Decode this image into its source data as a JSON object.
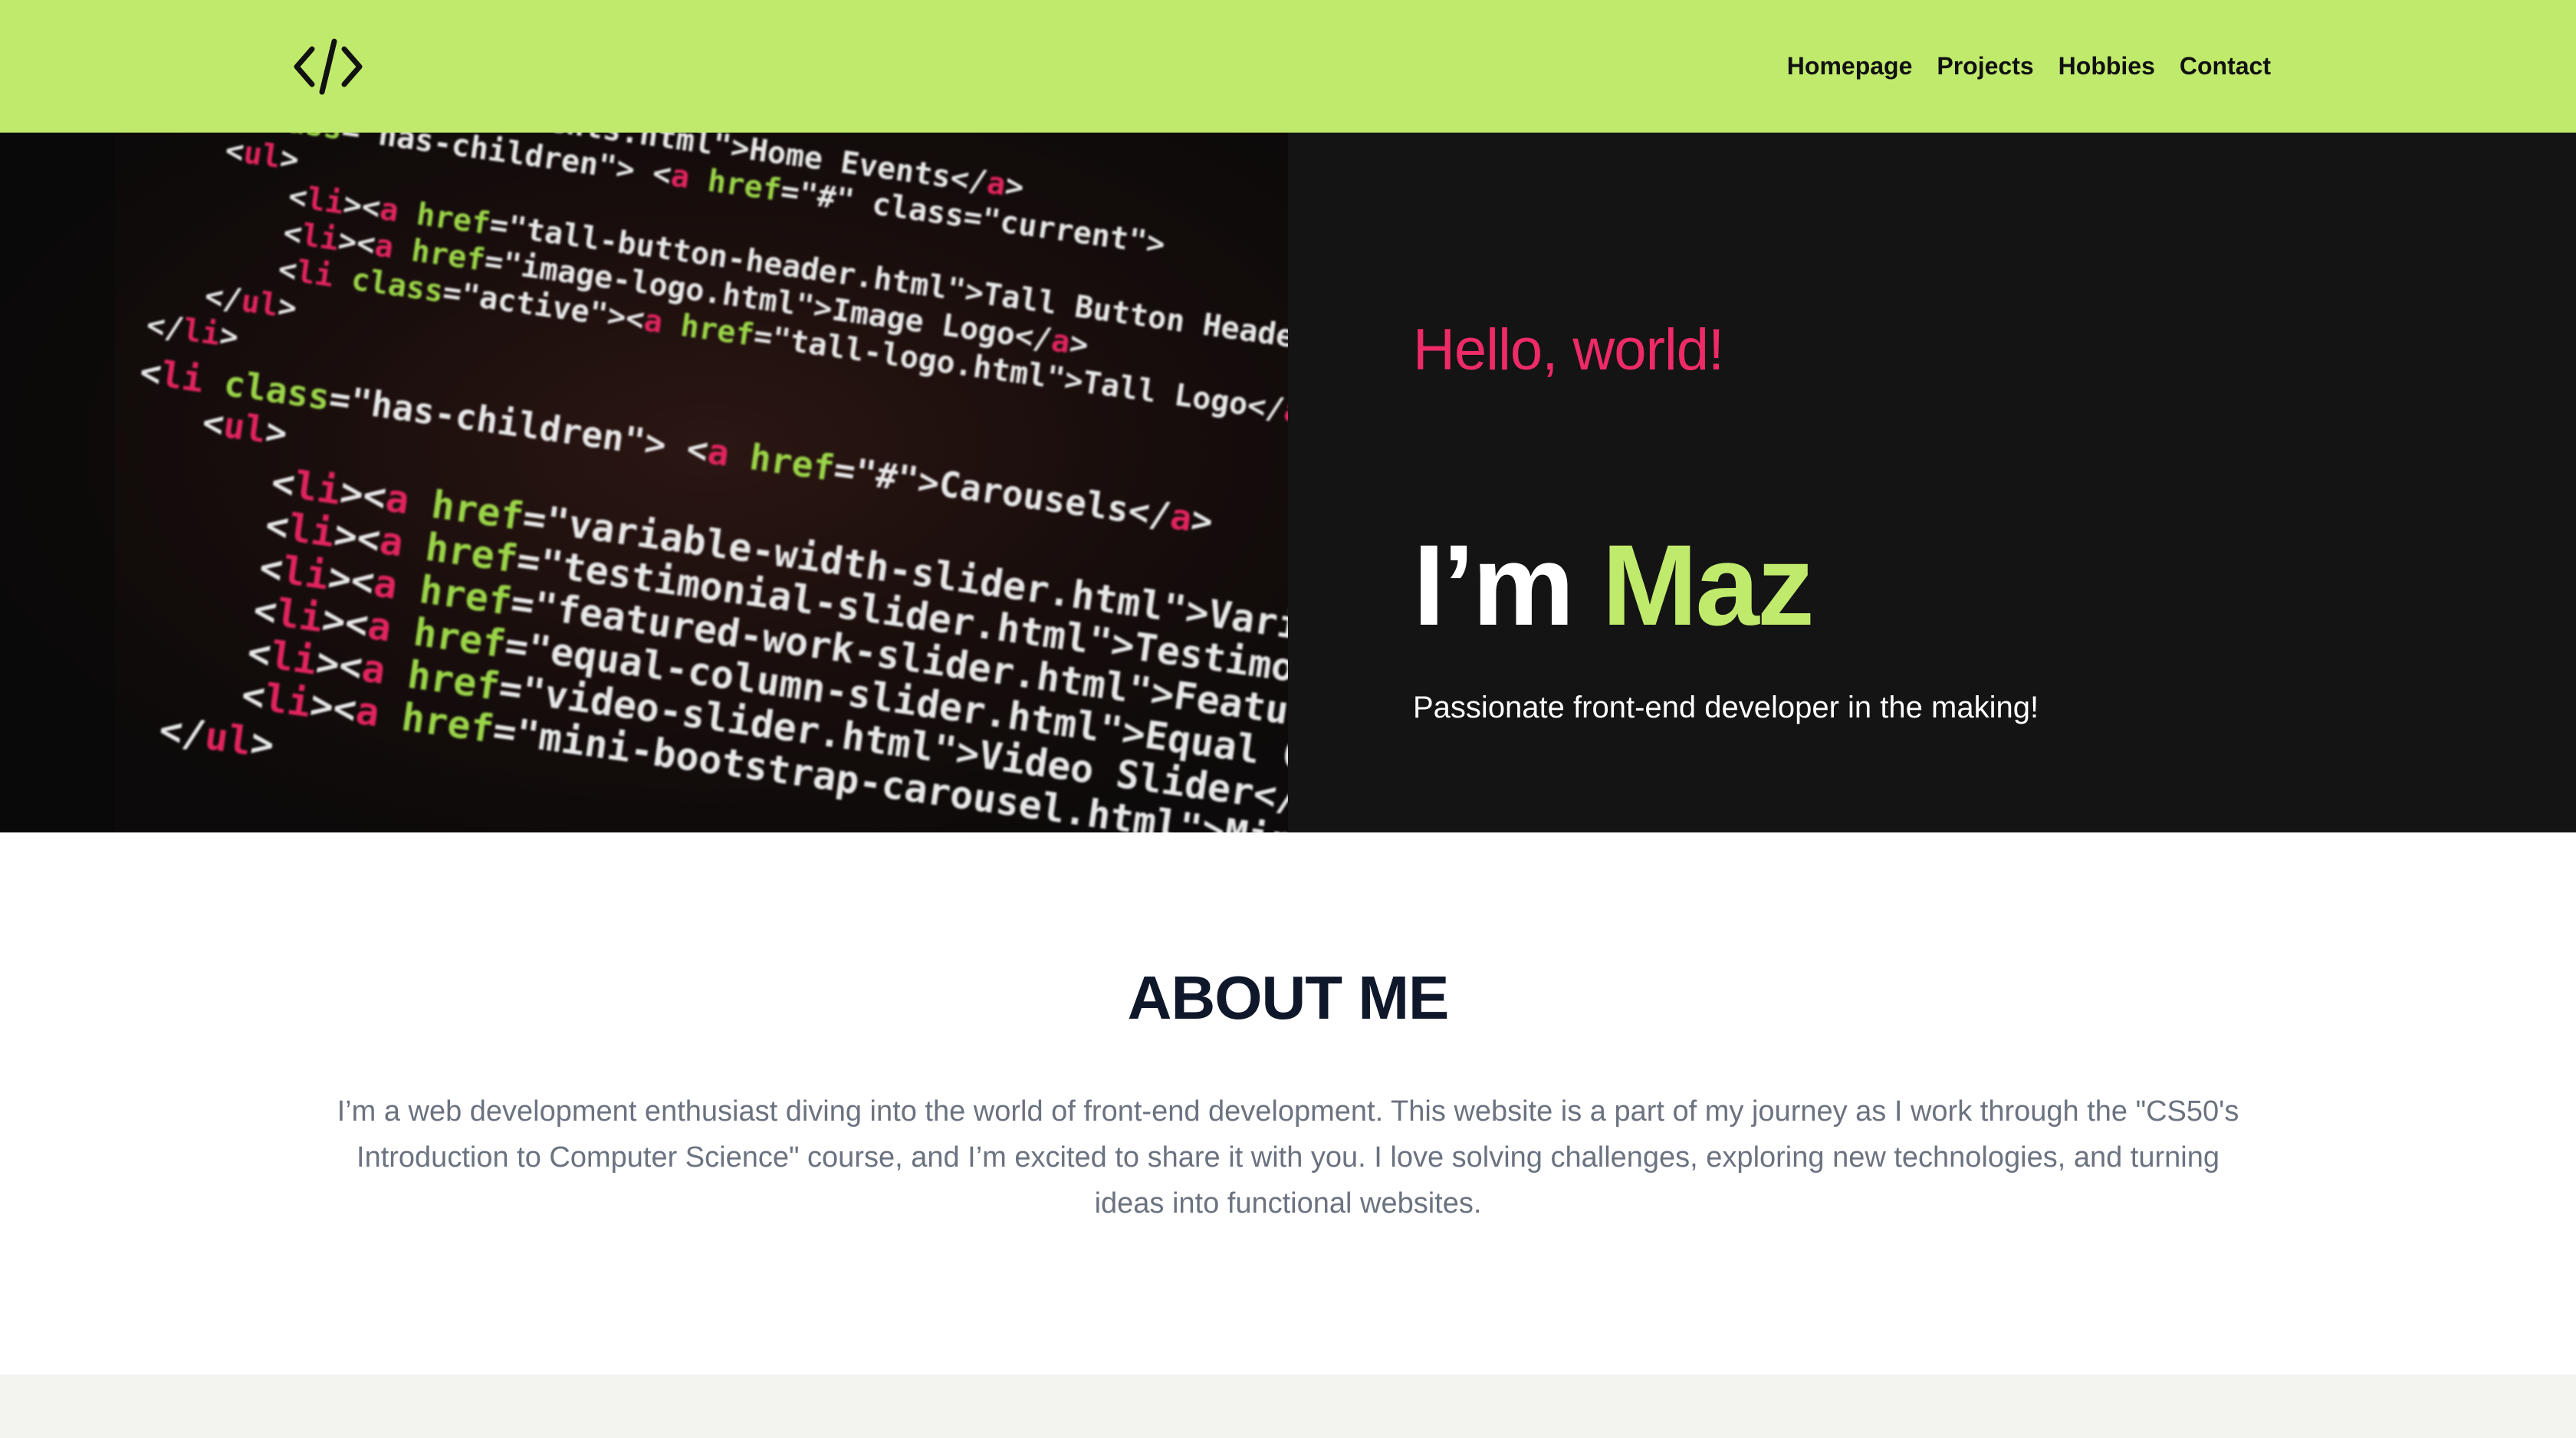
{
  "navbar": {
    "logo_icon": "code-brackets-icon",
    "links": [
      {
        "label": "Homepage"
      },
      {
        "label": "Projects"
      },
      {
        "label": "Hobbies"
      },
      {
        "label": "Contact"
      }
    ]
  },
  "hero": {
    "greeting": "Hello, world!",
    "headline_prefix": "I’m ",
    "headline_name": "Maz",
    "tagline": "Passionate front-end developer in the making!",
    "image_icon": "code-screen-photo"
  },
  "about": {
    "title": "ABOUT ME",
    "text": "I’m a web development enthusiast diving into the world of front-end development. This website is a part of my journey as I work through the \"CS50's Introduction to Computer Science\" course, and I’m excited to share it with you. I love solving challenges, exploring new technologies, and turning ideas into functional websites."
  },
  "colors": {
    "nav_bg": "#c0ea6c",
    "hero_bg": "#141414",
    "accent_pink": "#ee2a67",
    "accent_green": "#c0ea6c",
    "heading_dark": "#0f172a",
    "body_gray": "#6b7280",
    "footer_bg": "#f3f3f0"
  }
}
